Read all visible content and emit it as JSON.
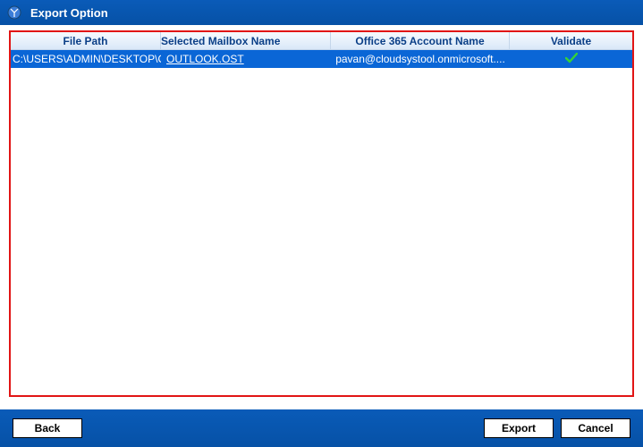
{
  "window": {
    "title": "Export Option"
  },
  "table": {
    "headers": {
      "file_path": "File Path",
      "mailbox": "Selected Mailbox Name",
      "account": "Office 365 Account Name",
      "validate": "Validate"
    },
    "rows": [
      {
        "file_path": "C:\\USERS\\ADMIN\\DESKTOP\\O...",
        "mailbox": "OUTLOOK.OST",
        "account": "pavan@cloudsystool.onmicrosoft....",
        "validate_icon": "checkmark-icon"
      }
    ]
  },
  "footer": {
    "back": "Back",
    "export": "Export",
    "cancel": "Cancel"
  }
}
